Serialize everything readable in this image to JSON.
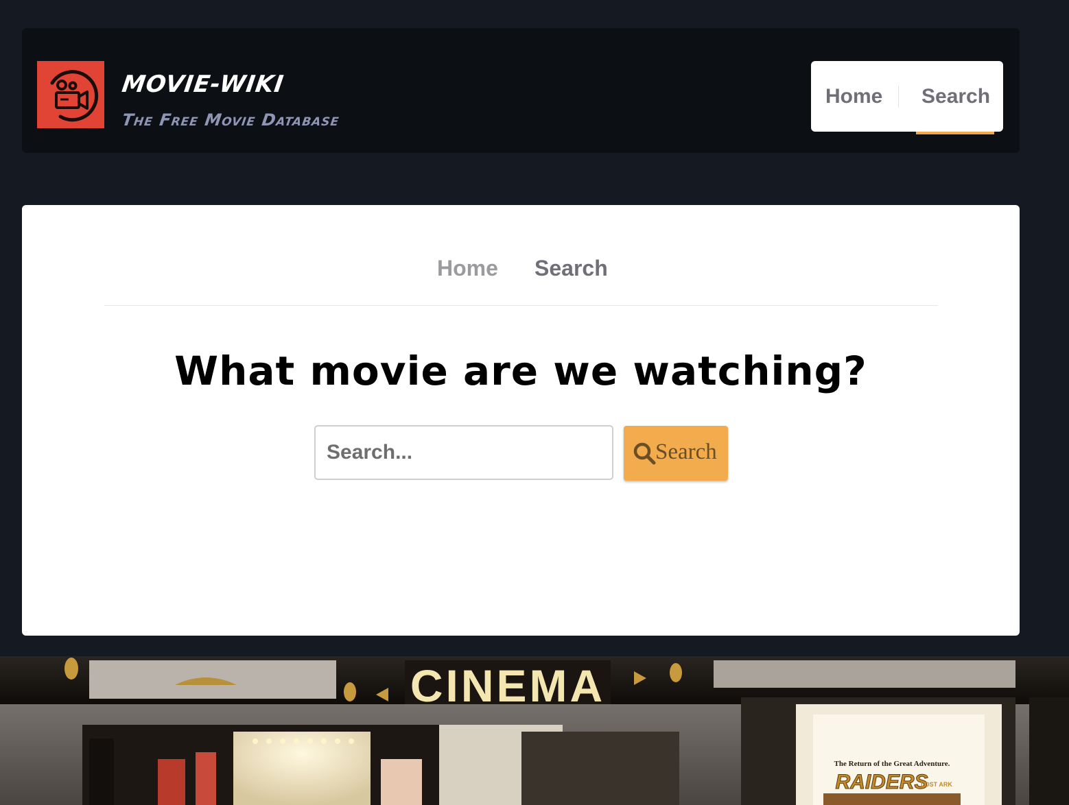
{
  "header": {
    "brand_title": "MOVIE-WIKI",
    "brand_tagline": "The Free Movie Database",
    "logo_icon": "video-camera-icon",
    "logo_color": "#e14434"
  },
  "top_nav": {
    "items": [
      {
        "label": "Home",
        "active": false
      },
      {
        "label": "Search",
        "active": true
      }
    ],
    "active_color": "#f2a748"
  },
  "sub_nav": {
    "items": [
      {
        "label": "Home"
      },
      {
        "label": "Search"
      }
    ]
  },
  "main": {
    "headline": "What movie are we watching?",
    "search": {
      "placeholder": "Search...",
      "value": "",
      "button_label": "Search",
      "button_icon": "search-icon",
      "button_color": "#f2ac4e"
    }
  },
  "banner": {
    "sign_text": "CINEMA",
    "poster_tagline": "The Return of the Great Adventure.",
    "poster_title": "RAIDERS",
    "poster_subtitle": "LOST ARK"
  }
}
